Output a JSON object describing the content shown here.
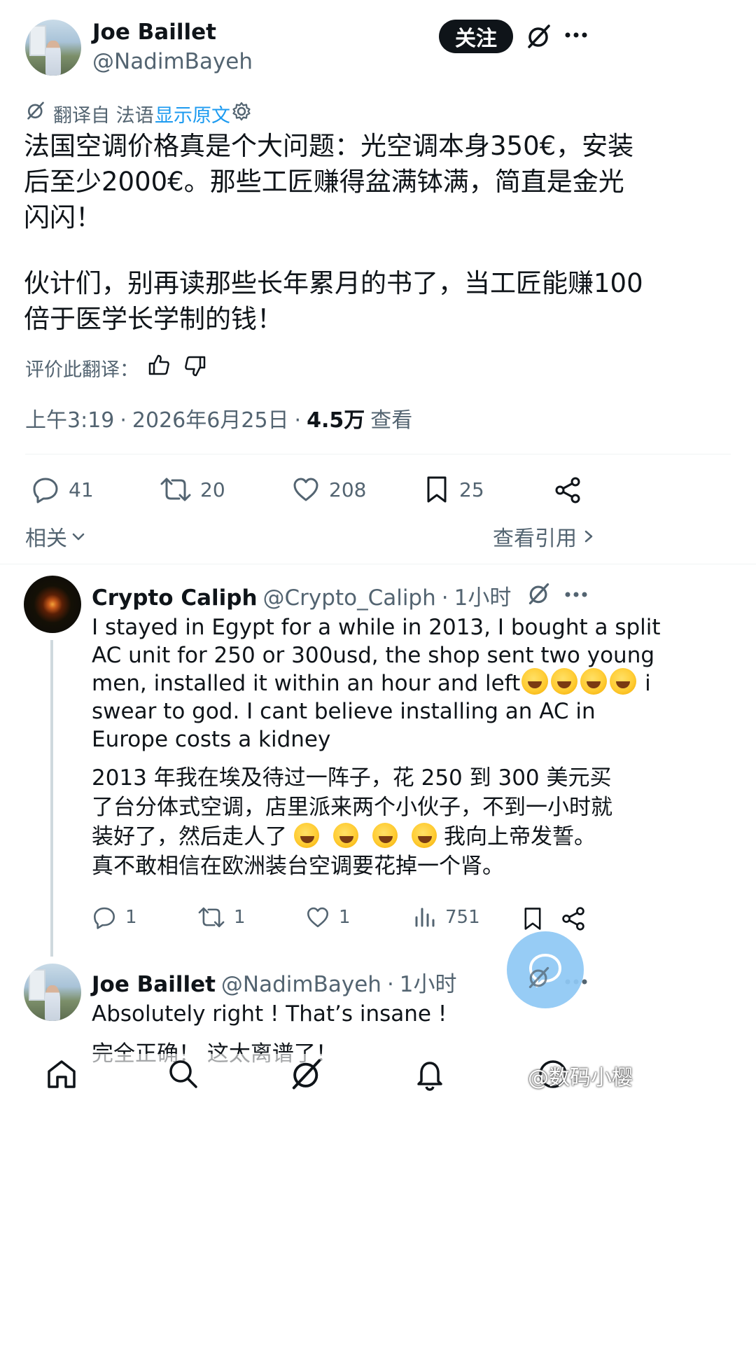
{
  "tweet": {
    "author_name": "Joe Baillet",
    "author_handle": "@NadimBayeh",
    "follow_label": "关注",
    "translate_from": "翻译自 法语",
    "show_original": "显示原文",
    "body_line1": "法国空调价格真是个大问题：光空调本身350€，安装",
    "body_line2": "后至少2000€。那些工匠赚得盆满钵满，简直是金光",
    "body_line3": "闪闪！",
    "body_line4": "伙计们，别再读那些长年累月的书了，当工匠能赚100",
    "body_line5": "倍于医学长学制的钱！",
    "rate_translation": "评价此翻译：",
    "time": "上午3:19",
    "date": "2026年6月25日",
    "views": "4.5万",
    "views_label": "查看",
    "replies": "41",
    "retweets": "20",
    "likes": "208",
    "bookmarks": "25",
    "related": "相关",
    "view_quotes": "查看引用"
  },
  "reply1": {
    "author_name": "Crypto Caliph",
    "author_handle": "@Crypto_Caliph",
    "time": "1小时",
    "en_line1": "I stayed in Egypt for a while in 2013, I bought a split",
    "en_line2": "AC unit for 250 or 300usd, the shop sent two young",
    "en_line3a": "men, installed it within an hour and left",
    "en_line3b": " i",
    "en_line4": "swear to god.  I cant believe installing an AC in",
    "en_line5": "Europe costs a kidney",
    "zh_line1": "2013 年我在埃及待过一阵子，花 250 到 300 美元买",
    "zh_line2": "了台分体式空调，店里派来两个小伙子，不到一小时就",
    "zh_line3a": "装好了，然后走人了",
    "zh_line3b": "我向上帝发誓。",
    "zh_line4": "真不敢相信在欧洲装台空调要花掉一个肾。",
    "replies": "1",
    "retweets": "1",
    "likes": "1",
    "views": "751"
  },
  "reply2": {
    "author_name": "Joe Baillet",
    "author_handle": "@NadimBayeh",
    "time": "1小时",
    "en_line1": "Absolutely right ! That’s insane !",
    "zh_line1": "完全正确！ 这太离谱了！"
  },
  "watermark": "@数码小樱",
  "colors": {
    "accent": "#1d9bf0",
    "text": "#0f1419",
    "muted": "#536471",
    "divider": "#eff3f4",
    "fab": "#8fc8f5"
  }
}
